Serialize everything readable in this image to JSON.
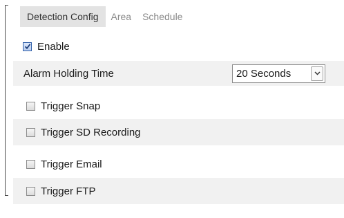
{
  "tabs": [
    {
      "label": "Detection Config",
      "active": true
    },
    {
      "label": "Area",
      "active": false
    },
    {
      "label": "Schedule",
      "active": false
    }
  ],
  "enable": {
    "label": "Enable",
    "checked": true
  },
  "alarm_holding_time": {
    "label": "Alarm Holding Time",
    "selected": "20 Seconds"
  },
  "triggers": [
    {
      "label": "Trigger Snap",
      "checked": false
    },
    {
      "label": "Trigger SD Recording",
      "checked": false
    },
    {
      "label": "Trigger Email",
      "checked": false
    },
    {
      "label": "Trigger FTP",
      "checked": false
    }
  ],
  "colors": {
    "active_tab_bg": "#e3e3e3",
    "row_shade": "#f1f1f1",
    "checkbox_checked": "#2f5fa8"
  }
}
